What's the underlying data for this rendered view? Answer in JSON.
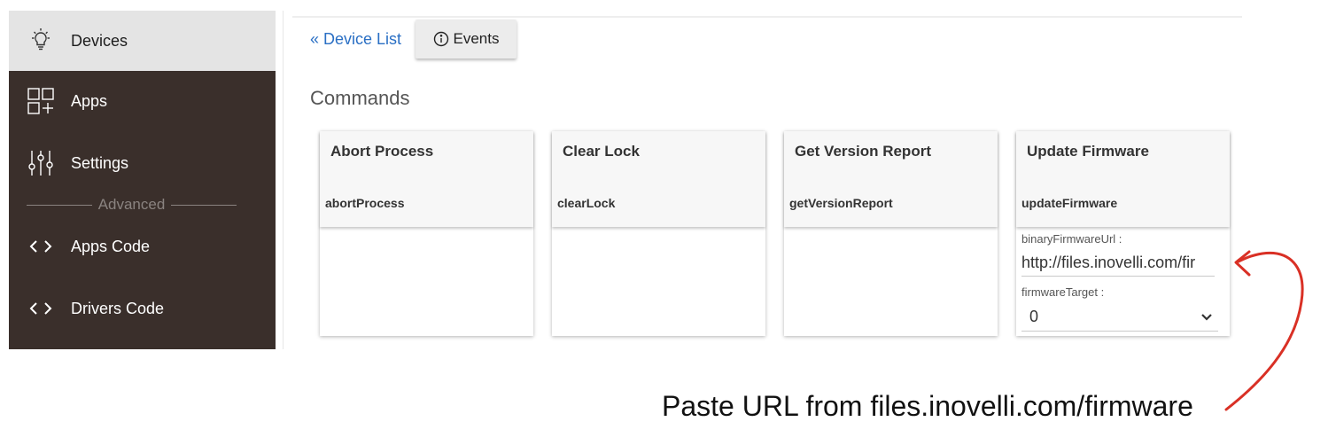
{
  "sidebar": {
    "items": [
      {
        "label": "Devices",
        "icon": "lightbulb-icon"
      },
      {
        "label": "Apps",
        "icon": "apps-grid-icon"
      },
      {
        "label": "Settings",
        "icon": "sliders-icon"
      },
      {
        "label": "Apps Code",
        "icon": "code-icon"
      },
      {
        "label": "Drivers Code",
        "icon": "code-icon"
      }
    ],
    "section_label": "Advanced"
  },
  "nav": {
    "back_link": "« Device List",
    "events_label": "Events",
    "events_icon": "info-icon"
  },
  "commands": {
    "title": "Commands",
    "cards": [
      {
        "title": "Abort Process",
        "command": "abortProcess"
      },
      {
        "title": "Clear Lock",
        "command": "clearLock"
      },
      {
        "title": "Get Version Report",
        "command": "getVersionReport"
      },
      {
        "title": "Update Firmware",
        "command": "updateFirmware",
        "params": {
          "url_label": "binaryFirmwareUrl :",
          "url_value": "http://files.inovelli.com/fir",
          "target_label": "firmwareTarget :",
          "target_value": "0"
        }
      }
    ]
  },
  "annotation": {
    "text": "Paste URL from files.inovelli.com/firmware",
    "arrow_color": "#d93025"
  },
  "colors": {
    "sidebar_bg": "#3a2f2b",
    "active_item_bg": "#e4e4e4",
    "link": "#2a6fc4"
  }
}
